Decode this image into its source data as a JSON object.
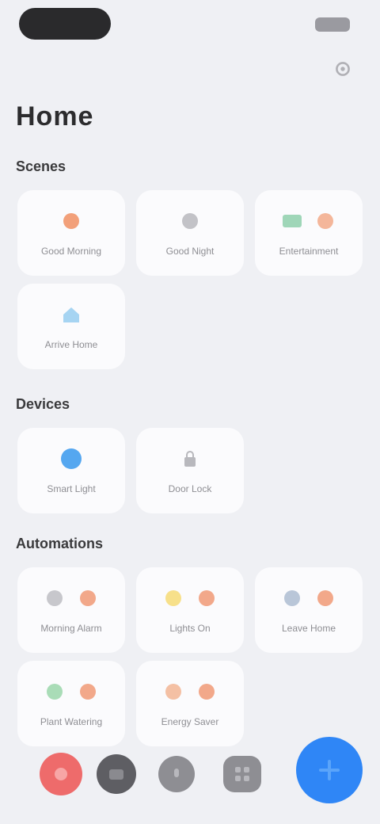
{
  "status_bar": {
    "time": "",
    "battery_icon": "battery-icon"
  },
  "header": {
    "title": "Home",
    "settings_icon": "gear-icon"
  },
  "sections": [
    {
      "title": "Scenes",
      "cards": [
        {
          "label": "Good Morning",
          "icons": [
            "sun-icon"
          ],
          "colors": [
            "#f2a07a"
          ]
        },
        {
          "label": "Good Night",
          "icons": [
            "moon-icon"
          ],
          "colors": [
            "#b8b8bd"
          ]
        },
        {
          "label": "Entertainment",
          "icons": [
            "tv-icon",
            "speaker-icon"
          ],
          "colors": [
            "#9fd6b8",
            "#f4b69a"
          ]
        },
        {
          "label": "Arrive Home",
          "icons": [
            "house-icon"
          ],
          "colors": [
            "#a6d4f2"
          ]
        }
      ]
    },
    {
      "title": "Devices",
      "cards": [
        {
          "label": "Smart Light",
          "icons": [
            "bulb-icon"
          ],
          "colors": [
            "#55a7f0"
          ]
        },
        {
          "label": "Door Lock",
          "icons": [
            "lock-icon"
          ],
          "colors": [
            "#b8b8bd"
          ]
        }
      ]
    },
    {
      "title": "Automations",
      "cards": [
        {
          "label": "Morning Alarm",
          "icons": [
            "alarm-icon",
            "arrow-icon"
          ],
          "colors": [
            "#c7c7cc",
            "#f2a88a"
          ]
        },
        {
          "label": "Lights On",
          "icons": [
            "sun-icon",
            "arrow-icon"
          ],
          "colors": [
            "#f7e08a",
            "#f2a88a"
          ]
        },
        {
          "label": "Leave Home",
          "icons": [
            "person-icon",
            "arrow-icon"
          ],
          "colors": [
            "#b9c6d8",
            "#f2a88a"
          ]
        },
        {
          "label": "Plant Watering",
          "icons": [
            "leaf-icon",
            "arrow-icon"
          ],
          "colors": [
            "#a9dcb7",
            "#f2a88a"
          ]
        },
        {
          "label": "Energy Saver",
          "icons": [
            "bolt-icon",
            "arrow-icon"
          ],
          "colors": [
            "#f4c0a4",
            "#f2a88a"
          ]
        }
      ]
    }
  ],
  "dock": {
    "items": [
      {
        "name": "record-icon",
        "color": "#ee5a5a"
      },
      {
        "name": "camera-icon",
        "color": "#6e6e73"
      },
      {
        "name": "mic-icon",
        "color": "#8e8e93"
      },
      {
        "name": "grid-icon",
        "color": "#8e8e93"
      }
    ],
    "fab_icon": "plus-icon",
    "fab_color": "#2f86f6"
  }
}
